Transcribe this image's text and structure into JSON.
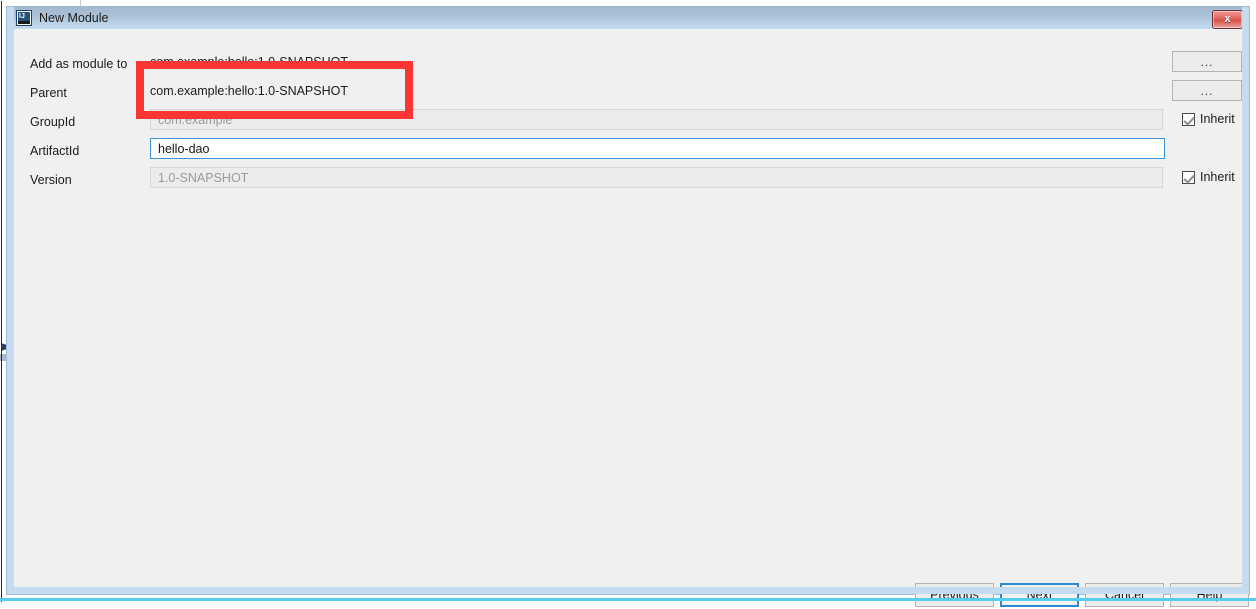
{
  "window": {
    "title": "New Module",
    "icon": "intellij-idea-icon",
    "close_label": "x",
    "accent_blue": "#3f93d8",
    "annotation_color": "#fb3434",
    "titlebar_gradient_top": "#a2b9d1",
    "titlebar_gradient_bottom": "#c3d9ee",
    "body_background": "#f0f0f0"
  },
  "form": {
    "rows": [
      {
        "label": "Add as module to",
        "value": "com.example:hello:1.0-SNAPSHOT",
        "type": "combo",
        "browse_label": "...",
        "inherit": null
      },
      {
        "label": "Parent",
        "value": "com.example:hello:1.0-SNAPSHOT",
        "type": "combo",
        "browse_label": "...",
        "inherit": null
      },
      {
        "label": "GroupId",
        "value": "com.example",
        "type": "text-disabled",
        "browse_label": null,
        "inherit": "Inherit"
      },
      {
        "label": "ArtifactId",
        "value": "hello-dao",
        "type": "text-active",
        "browse_label": null,
        "inherit": null
      },
      {
        "label": "Version",
        "value": "1.0-SNAPSHOT",
        "type": "text-disabled",
        "browse_label": null,
        "inherit": "Inherit"
      }
    ]
  },
  "footer": {
    "buttons": [
      {
        "label": "Previous",
        "mnemonic": "P",
        "focused": false
      },
      {
        "label": "Next",
        "mnemonic": "N",
        "focused": true
      },
      {
        "label": "Cancel",
        "mnemonic": "",
        "focused": false
      },
      {
        "label": "Help",
        "mnemonic": "",
        "focused": false
      }
    ]
  }
}
